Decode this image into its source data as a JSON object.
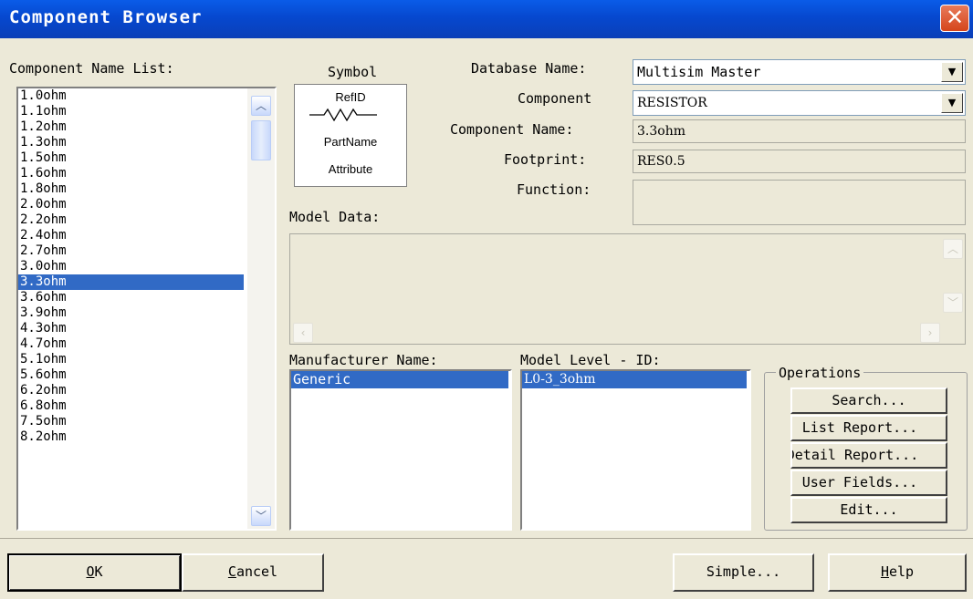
{
  "window": {
    "title": "Component Browser"
  },
  "labels": {
    "component_name_list": "Component Name List:",
    "symbol": "Symbol",
    "database_name": "Database Name:",
    "component_family": "Component",
    "component_name": "Component Name:",
    "footprint": "Footprint:",
    "function": "Function:",
    "model_data": "Model Data:",
    "manufacturer_name": "Manufacturer Name:",
    "model_level_id": "Model Level - ID:",
    "operations": "Operations"
  },
  "symbol_preview": {
    "ref_id": "RefID",
    "part_name": "PartName",
    "attribute": "Attribute"
  },
  "component_list": [
    "1.0ohm",
    "1.1ohm",
    "1.2ohm",
    "1.3ohm",
    "1.5ohm",
    "1.6ohm",
    "1.8ohm",
    "2.0ohm",
    "2.2ohm",
    "2.4ohm",
    "2.7ohm",
    "3.0ohm",
    "3.3ohm",
    "3.6ohm",
    "3.9ohm",
    "4.3ohm",
    "4.7ohm",
    "5.1ohm",
    "5.6ohm",
    "6.2ohm",
    "6.8ohm",
    "7.5ohm",
    "8.2ohm"
  ],
  "selected_component_index": 12,
  "fields": {
    "database_name": "Multisim Master",
    "component_family": "RESISTOR",
    "component_name": "3.3ohm",
    "footprint": "RES0.5",
    "function": ""
  },
  "manufacturers": [
    "Generic"
  ],
  "model_levels": [
    "L0-3_3ohm"
  ],
  "operations": {
    "search": "Search...",
    "list_report": "List Report...",
    "detail_report": "Detail Report...",
    "user_fields": "User Fields...",
    "edit": "Edit..."
  },
  "buttons": {
    "ok_u": "O",
    "ok_rest": "K",
    "cancel_u": "C",
    "cancel_rest": "ancel",
    "simple": "Simple...",
    "help_u": "H",
    "help_rest": "elp"
  },
  "colors": {
    "titlebar": "#0a5ce8",
    "selection": "#316ac5",
    "dialog_bg": "#ece9d8"
  }
}
